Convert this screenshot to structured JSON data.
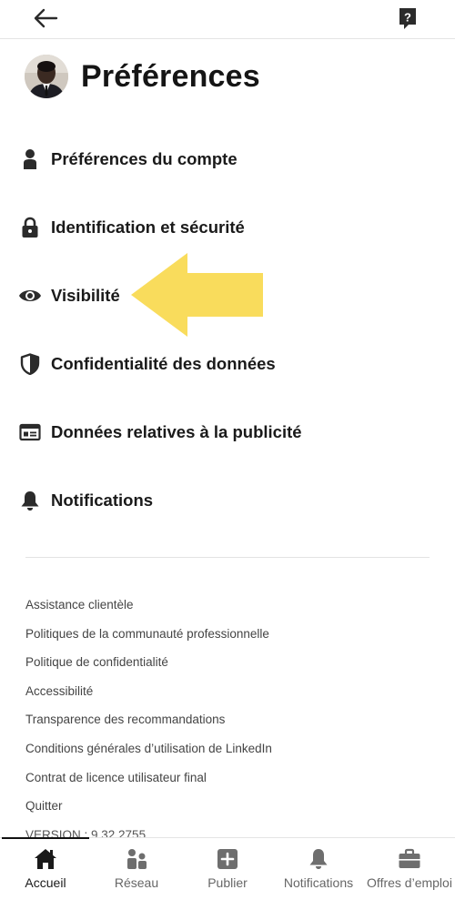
{
  "topbar": {
    "back_icon": "arrow-left-icon",
    "help_icon": "question-mark-icon"
  },
  "header": {
    "title": "Préférences",
    "avatar": "profile-avatar"
  },
  "settings": {
    "items": [
      {
        "label": "Préférences du compte",
        "icon": "person-icon"
      },
      {
        "label": "Identification et sécurité",
        "icon": "lock-icon"
      },
      {
        "label": "Visibilité",
        "icon": "eye-icon"
      },
      {
        "label": "Confidentialité des données",
        "icon": "shield-icon"
      },
      {
        "label": "Données relatives à la publicité",
        "icon": "ad-card-icon"
      },
      {
        "label": "Notifications",
        "icon": "bell-icon"
      }
    ]
  },
  "annotation": {
    "arrow_color": "#f9dc5c",
    "arrow_icon": "pointer-arrow-icon"
  },
  "footer": {
    "links": [
      "Assistance clientèle",
      "Politiques de la communauté professionnelle",
      "Politique de confidentialité",
      "Accessibilité",
      "Transparence des recommandations",
      "Conditions générales d’utilisation de LinkedIn",
      "Contrat de licence utilisateur final",
      "Quitter"
    ],
    "version": "VERSION : 9.32.2755"
  },
  "bottom_nav": {
    "items": [
      {
        "label": "Accueil",
        "icon": "home-icon",
        "active": true
      },
      {
        "label": "Réseau",
        "icon": "network-icon",
        "active": false
      },
      {
        "label": "Publier",
        "icon": "plus-square-icon",
        "active": false
      },
      {
        "label": "Notifications",
        "icon": "bell-icon",
        "active": false
      },
      {
        "label": "Offres d’emploi",
        "icon": "briefcase-icon",
        "active": false
      }
    ]
  },
  "colors": {
    "text_primary": "#1a1a1a",
    "text_secondary": "#444444",
    "icon_dark": "#2b2b2b",
    "nav_icon": "#6e6e6e"
  }
}
